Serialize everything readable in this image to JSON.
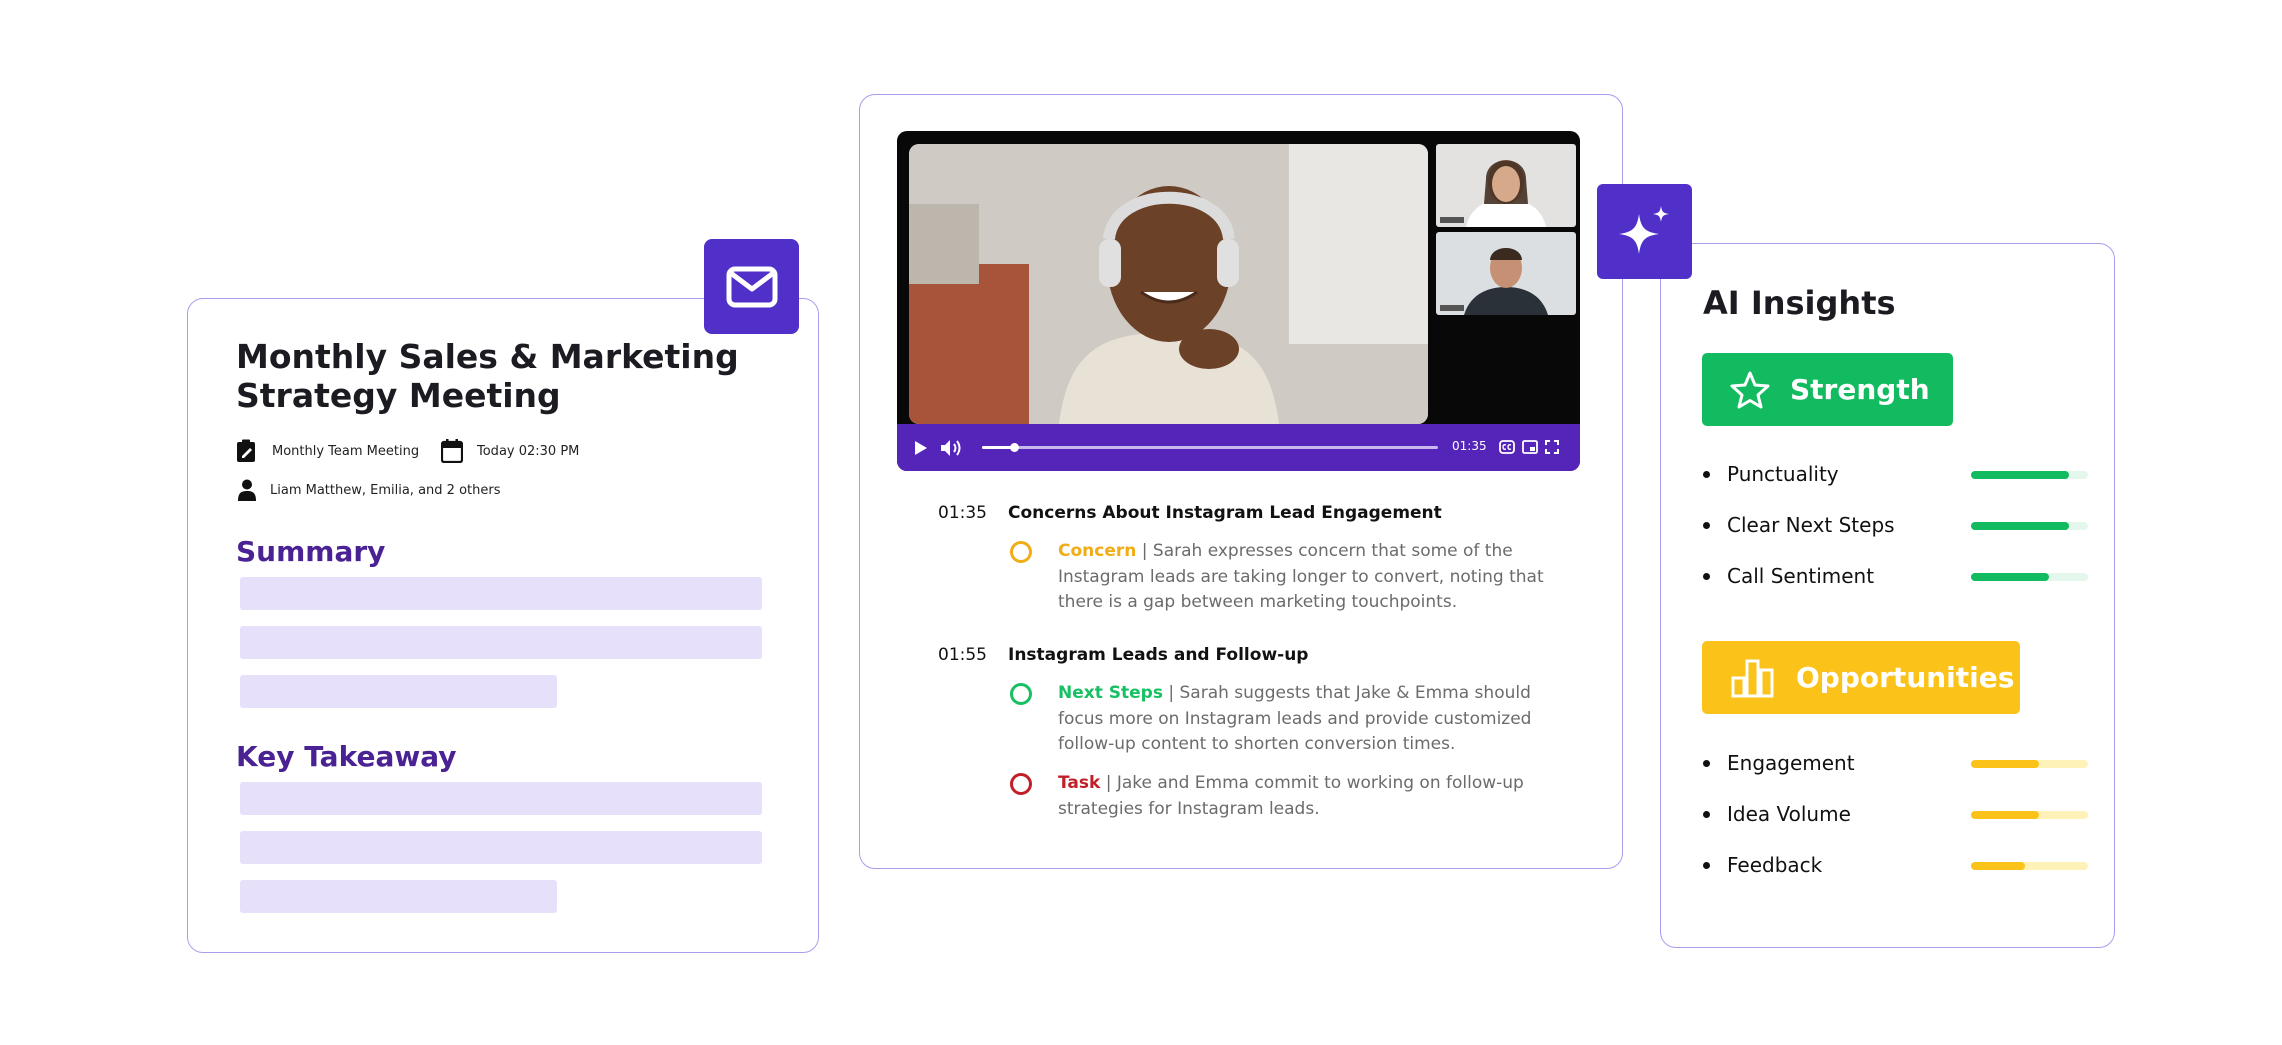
{
  "colors": {
    "accent": "#5030c8",
    "card_border": "#a79ef0",
    "section_heading": "#4a2294",
    "placeholder": "#e6e0fb",
    "concern": "#f0ad17",
    "next_steps": "#17c063",
    "task": "#c0202a",
    "strength": "#12bb5f",
    "strength_track": "#e3f7ec",
    "opportunities": "#fbc21a",
    "opportunities_track": "#fef2b8"
  },
  "meeting": {
    "title": "Monthly Sales & Marketing Strategy Meeting",
    "meeting_type": "Monthly Team Meeting",
    "datetime": "Today 02:30 PM",
    "attendees": "Liam Matthew, Emilia, and 2 others",
    "summary_heading": "Summary",
    "takeaway_heading": "Key Takeaway",
    "icons": [
      "mail-icon",
      "edit-note-icon",
      "calendar-icon",
      "person-icon"
    ]
  },
  "video": {
    "current_time": "01:35",
    "progress": 0.07,
    "controls": [
      "play-icon",
      "volume-icon",
      "captions-icon",
      "pip-icon",
      "fullscreen-icon"
    ]
  },
  "timeline": [
    {
      "time": "01:35",
      "title": "Concerns About Instagram Lead Engagement",
      "items": [
        {
          "tag": "Concern",
          "text": "| Sarah expresses concern that some of the Instagram leads are taking longer to convert, noting that there is a gap between marketing touchpoints.",
          "color": "#f0ad17"
        }
      ]
    },
    {
      "time": "01:55",
      "title": "Instagram Leads and Follow-up",
      "items": [
        {
          "tag": "Next Steps",
          "text": "| Sarah suggests that Jake & Emma should focus more on Instagram leads and provide customized follow-up content to shorten conversion times.",
          "color": "#17c063"
        },
        {
          "tag": "Task",
          "text": "| Jake and Emma commit to working on follow-up strategies for Instagram leads.",
          "color": "#c0202a"
        }
      ]
    }
  ],
  "insights": {
    "title": "AI Insights",
    "strength": {
      "label": "Strength",
      "icon": "star-icon",
      "metrics": [
        {
          "label": "Punctuality",
          "value": 0.84
        },
        {
          "label": "Clear Next Steps",
          "value": 0.84
        },
        {
          "label": "Call Sentiment",
          "value": 0.67
        }
      ]
    },
    "opportunities": {
      "label": "Opportunities",
      "icon": "bar-chart-icon",
      "metrics": [
        {
          "label": "Engagement",
          "value": 0.58
        },
        {
          "label": "Idea Volume",
          "value": 0.58
        },
        {
          "label": "Feedback",
          "value": 0.46
        }
      ]
    }
  }
}
